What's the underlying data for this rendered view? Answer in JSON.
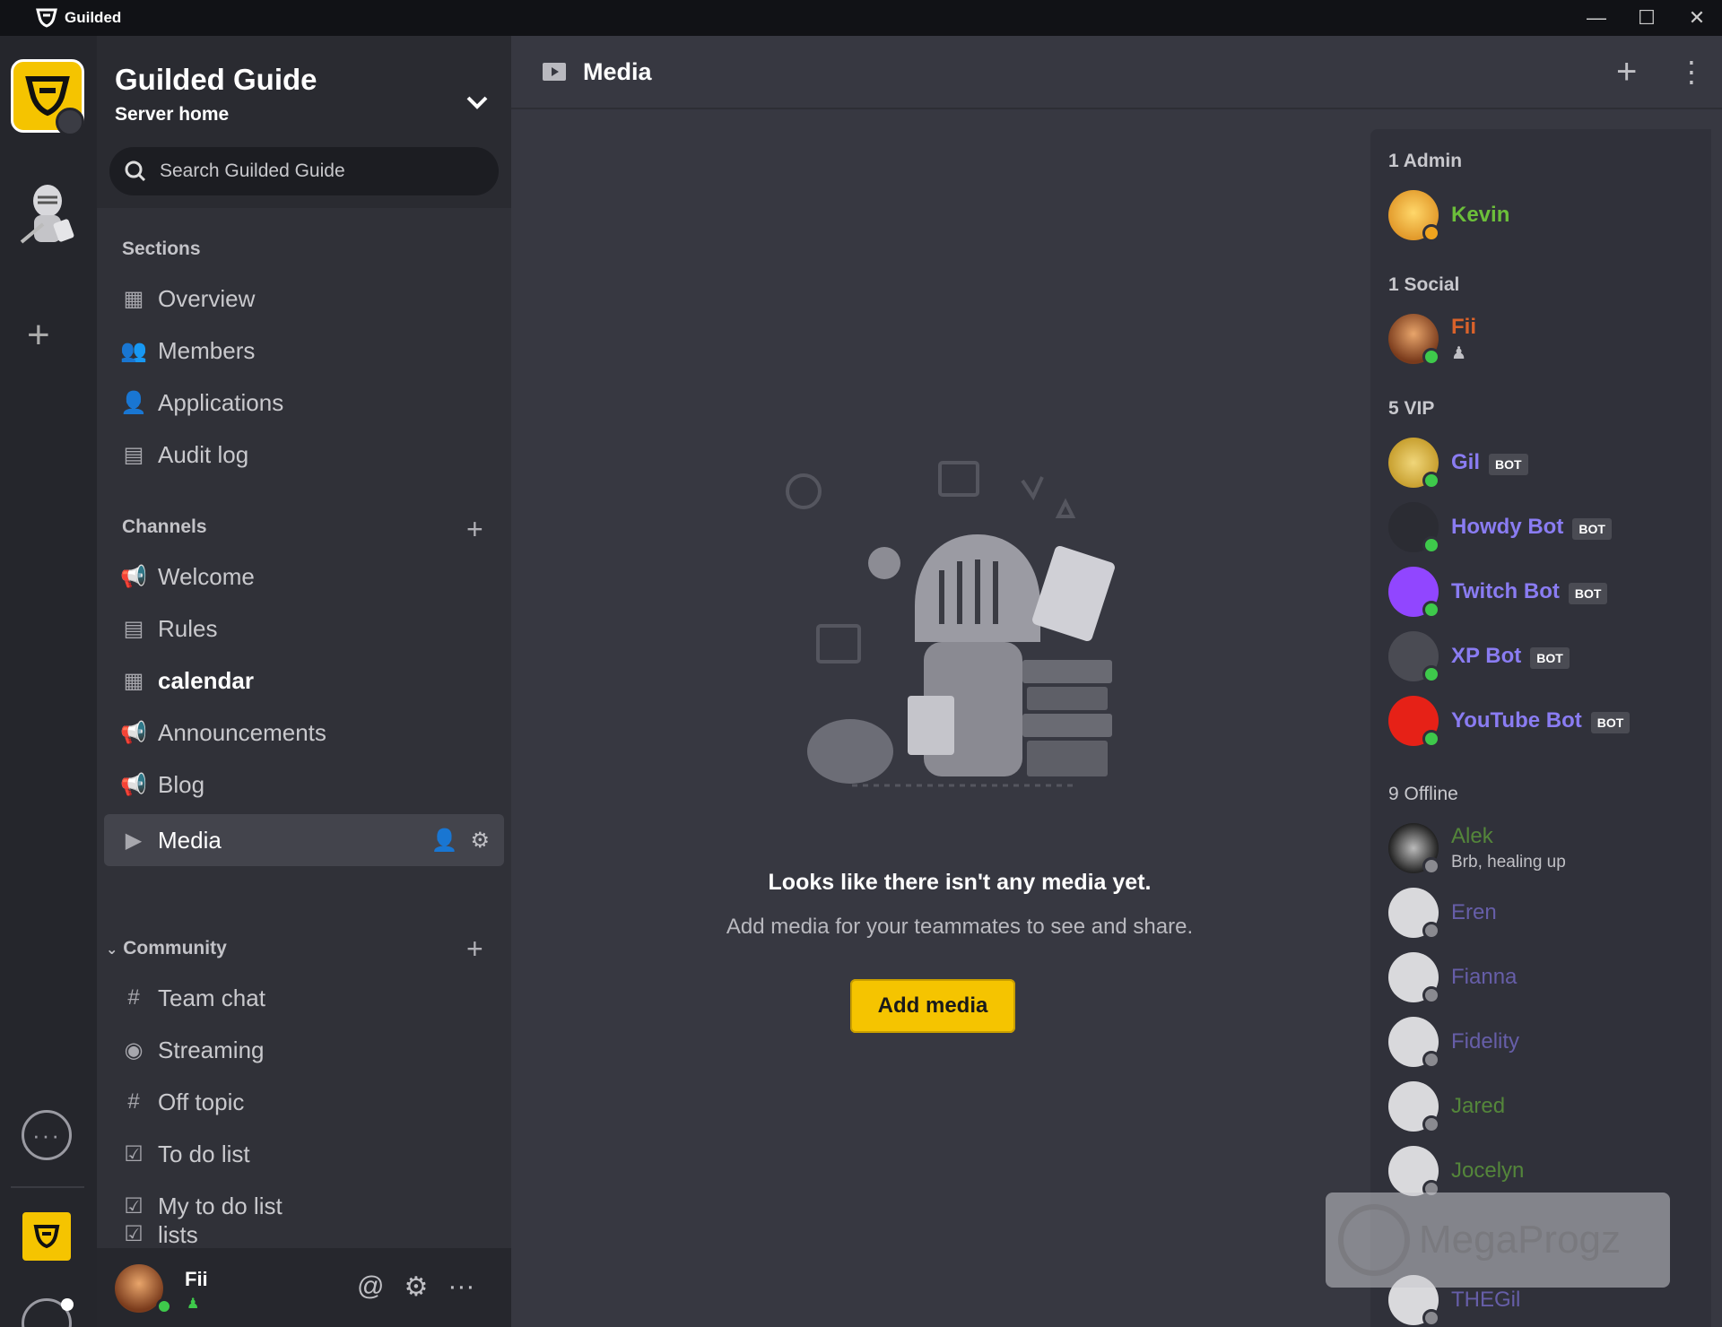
{
  "titlebar": {
    "app_name": "Guilded",
    "minimize": "—",
    "maximize": "☐",
    "close": "✕"
  },
  "server": {
    "name": "Guilded Guide",
    "subtitle": "Server home",
    "search_placeholder": "Search Guilded Guide"
  },
  "sections": {
    "label": "Sections",
    "items": [
      {
        "label": "Overview",
        "icon": "overview-icon"
      },
      {
        "label": "Members",
        "icon": "members-icon"
      },
      {
        "label": "Applications",
        "icon": "applications-icon"
      },
      {
        "label": "Audit log",
        "icon": "audit-log-icon"
      }
    ]
  },
  "channels": {
    "label": "Channels",
    "items": [
      {
        "label": "Welcome",
        "icon": "megaphone-icon"
      },
      {
        "label": "Rules",
        "icon": "document-icon"
      },
      {
        "label": "calendar",
        "icon": "calendar-icon"
      },
      {
        "label": "Announcements",
        "icon": "megaphone-icon"
      },
      {
        "label": "Blog",
        "icon": "megaphone-icon"
      },
      {
        "label": "Media",
        "icon": "media-icon"
      }
    ]
  },
  "community": {
    "label": "Community",
    "items": [
      {
        "label": "Team chat",
        "icon": "hash-icon"
      },
      {
        "label": "Streaming",
        "icon": "stream-icon"
      },
      {
        "label": "Off topic",
        "icon": "hash-icon"
      },
      {
        "label": "To do list",
        "icon": "checkbox-icon"
      },
      {
        "label": "My to do list",
        "icon": "checkbox-icon"
      },
      {
        "label": "lists",
        "icon": "checkbox-icon"
      }
    ]
  },
  "user": {
    "name": "Fii",
    "status_color": "#3ec94b"
  },
  "main": {
    "channel_title": "Media",
    "empty_title": "Looks like there isn't any media yet.",
    "empty_subtitle": "Add media for your teammates to see and share.",
    "add_button": "Add media"
  },
  "members": {
    "admin_label": "1 Admin",
    "social_label": "1 Social",
    "vip_label": "5 VIP",
    "offline_label": "9 Offline",
    "admin": [
      {
        "name": "Kevin",
        "color": "#6cbf3a",
        "status": "#f0a41e"
      }
    ],
    "social": [
      {
        "name": "Fii",
        "color": "#d9622b",
        "status": "#3ec94b"
      }
    ],
    "vip": [
      {
        "name": "Gil",
        "badge": "BOT",
        "color": "#8a7cf2"
      },
      {
        "name": "Howdy Bot",
        "badge": "BOT",
        "color": "#8a7cf2"
      },
      {
        "name": "Twitch Bot",
        "badge": "BOT",
        "color": "#8a7cf2"
      },
      {
        "name": "XP Bot",
        "badge": "BOT",
        "color": "#8a7cf2"
      },
      {
        "name": "YouTube Bot",
        "badge": "BOT",
        "color": "#8a7cf2"
      }
    ],
    "offline": [
      {
        "name": "Alek",
        "status_text": "Brb, healing up",
        "color": "#6cbf3a"
      },
      {
        "name": "Eren",
        "color": "#8a7cf2"
      },
      {
        "name": "Fianna",
        "color": "#8a7cf2"
      },
      {
        "name": "Fidelity",
        "color": "#8a7cf2"
      },
      {
        "name": "Jared",
        "color": "#6cbf3a"
      },
      {
        "name": "Jocelyn",
        "color": "#6cbf3a"
      },
      {
        "name": "THEGil",
        "color": "#8a7cf2"
      }
    ]
  },
  "watermark": {
    "text": "MegaProgz"
  }
}
